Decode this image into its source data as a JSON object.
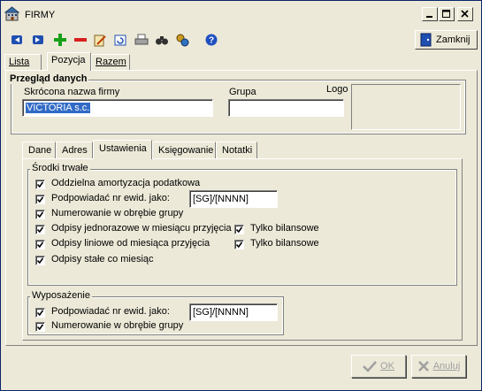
{
  "window": {
    "title": "FIRMY"
  },
  "toolbar": {
    "icons": [
      "first-icon",
      "next-icon",
      "add-icon",
      "delete-icon",
      "edit-icon",
      "refresh-icon",
      "print-icon",
      "find-icon",
      "settings-icon",
      "help-icon"
    ],
    "close_label": "Zamknij"
  },
  "top_tabs": [
    {
      "label": "Lista"
    },
    {
      "label": "Pozycja"
    },
    {
      "label": "Razem"
    }
  ],
  "overview": {
    "title": "Przegląd danych",
    "short_name_label": "Skrócona nazwa firmy",
    "short_name_value": "VICTORIA s.c.",
    "group_label": "Grupa",
    "group_value": "",
    "logo_label": "Logo"
  },
  "inner_tabs": [
    {
      "label": "Dane"
    },
    {
      "label": "Adres"
    },
    {
      "label": "Ustawienia"
    },
    {
      "label": "Księgowanie"
    },
    {
      "label": "Notatki"
    }
  ],
  "fixed_assets": {
    "legend": "Środki trwałe",
    "items": [
      {
        "label": "Oddzielna amortyzacja podatkowa",
        "checked": true
      },
      {
        "label": "Podpowiadać nr ewid. jako:",
        "checked": true,
        "field": "[SG]/[NNNN]"
      },
      {
        "label": "Numerowanie w obrębie grupy",
        "checked": true
      },
      {
        "label": "Odpisy jednorazowe w miesiącu przyjęcia",
        "checked": true,
        "extra_label": "Tylko bilansowe",
        "extra_checked": true
      },
      {
        "label": "Odpisy liniowe od miesiąca przyjęcia",
        "checked": true,
        "extra_label": "Tylko bilansowe",
        "extra_checked": true
      },
      {
        "label": "Odpisy stałe co miesiąc",
        "checked": true
      }
    ]
  },
  "equipment": {
    "legend": "Wyposażenie",
    "items": [
      {
        "label": "Podpowiadać nr ewid. jako:",
        "checked": true,
        "field": "[SG]/[NNNN]"
      },
      {
        "label": "Numerowanie w obrębie grupy",
        "checked": true
      }
    ]
  },
  "buttons": {
    "ok": "OK",
    "cancel": "Anuluj"
  }
}
